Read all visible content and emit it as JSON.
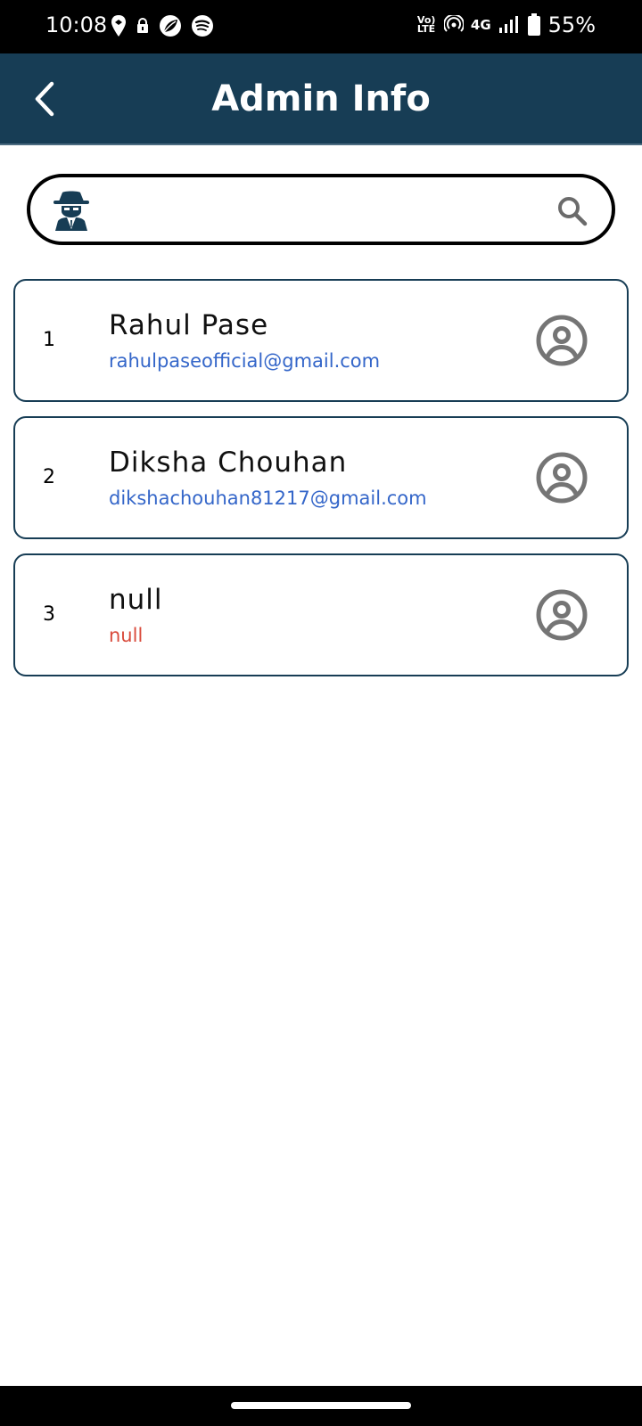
{
  "status_bar": {
    "time": "10:08",
    "battery": "55%",
    "volte": "Vo) LTE",
    "network": "4G"
  },
  "app_bar": {
    "title": "Admin Info"
  },
  "search": {
    "value": "",
    "placeholder": ""
  },
  "admins": [
    {
      "index": "1",
      "name": "Rahul Pase",
      "email": "rahulpaseofficial@gmail.com"
    },
    {
      "index": "2",
      "name": "Diksha Chouhan",
      "email": "dikshachouhan81217@gmail.com"
    },
    {
      "index": "3",
      "name": "null",
      "email": "null"
    }
  ],
  "colors": {
    "app_bar": "#173d55",
    "email": "#3466c9",
    "null_email": "#d94b3c",
    "avatar": "#757575"
  }
}
